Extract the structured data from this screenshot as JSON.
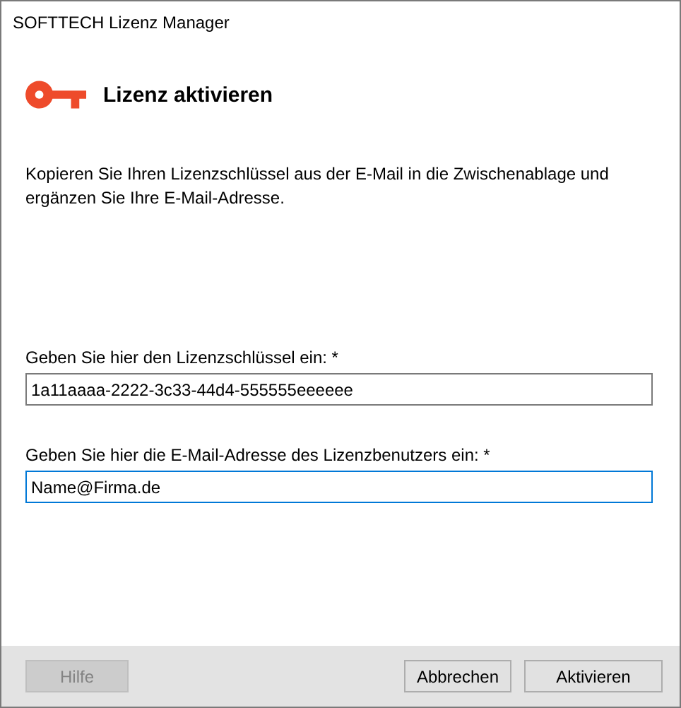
{
  "window": {
    "title": "SOFTTECH Lizenz Manager"
  },
  "header": {
    "title": "Lizenz aktivieren"
  },
  "description": "Kopieren Sie Ihren Lizenzschlüssel aus der E-Mail in die Zwischenablage und ergänzen Sie Ihre E-Mail-Adresse.",
  "fields": [
    {
      "label": "Geben Sie hier den Lizenzschlüssel ein: *",
      "value": "1a11aaaa-2222-3c33-44d4-555555eeeeee",
      "focused": false
    },
    {
      "label": "Geben Sie hier die E-Mail-Adresse des Lizenzbenutzers ein: *",
      "value": "Name@Firma.de",
      "focused": true
    }
  ],
  "buttons": [
    {
      "label": "Hilfe",
      "disabled": true
    },
    {
      "label": "Abbrechen",
      "disabled": false
    },
    {
      "label": "Aktivieren",
      "disabled": false
    }
  ]
}
